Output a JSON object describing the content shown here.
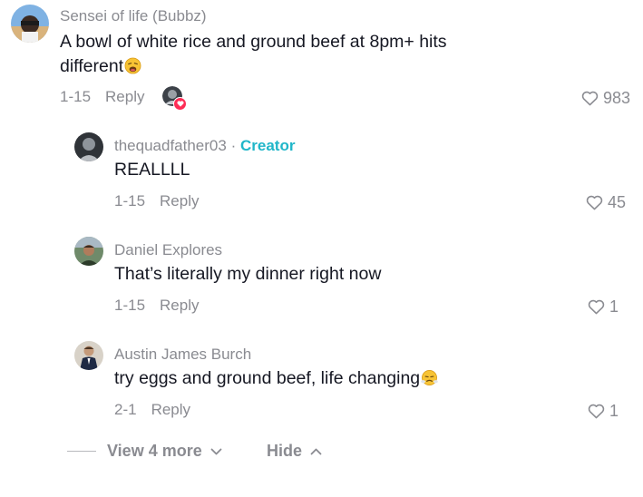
{
  "comment": {
    "username": "Sensei of life (Bubbz)",
    "text_line1": "A bowl of white rice and ground beef at 8pm+ hits",
    "text_line2": "different",
    "date": "1-15",
    "reply_label": "Reply",
    "likes": "983",
    "emoji_icon": "weary-face-emoji",
    "creator_liked": true
  },
  "replies": [
    {
      "username": "thequadfather03",
      "separator": "·",
      "badge": "Creator",
      "text": "REALLLL",
      "date": "1-15",
      "reply_label": "Reply",
      "likes": "45"
    },
    {
      "username": "Daniel Explores",
      "text": "That’s literally my dinner right now",
      "date": "1-15",
      "reply_label": "Reply",
      "likes": "1"
    },
    {
      "username": "Austin James Burch",
      "text": "try eggs and ground beef, life changing",
      "emoji_icon": "face-with-steam-emoji",
      "date": "2-1",
      "reply_label": "Reply",
      "likes": "1"
    }
  ],
  "thread_controls": {
    "view_more_label": "View 4 more",
    "hide_label": "Hide"
  },
  "colors": {
    "text": "#161823",
    "muted": "#8a8b91",
    "creator_badge": "#20b6c9",
    "heart_badge": "#fe2c55"
  }
}
